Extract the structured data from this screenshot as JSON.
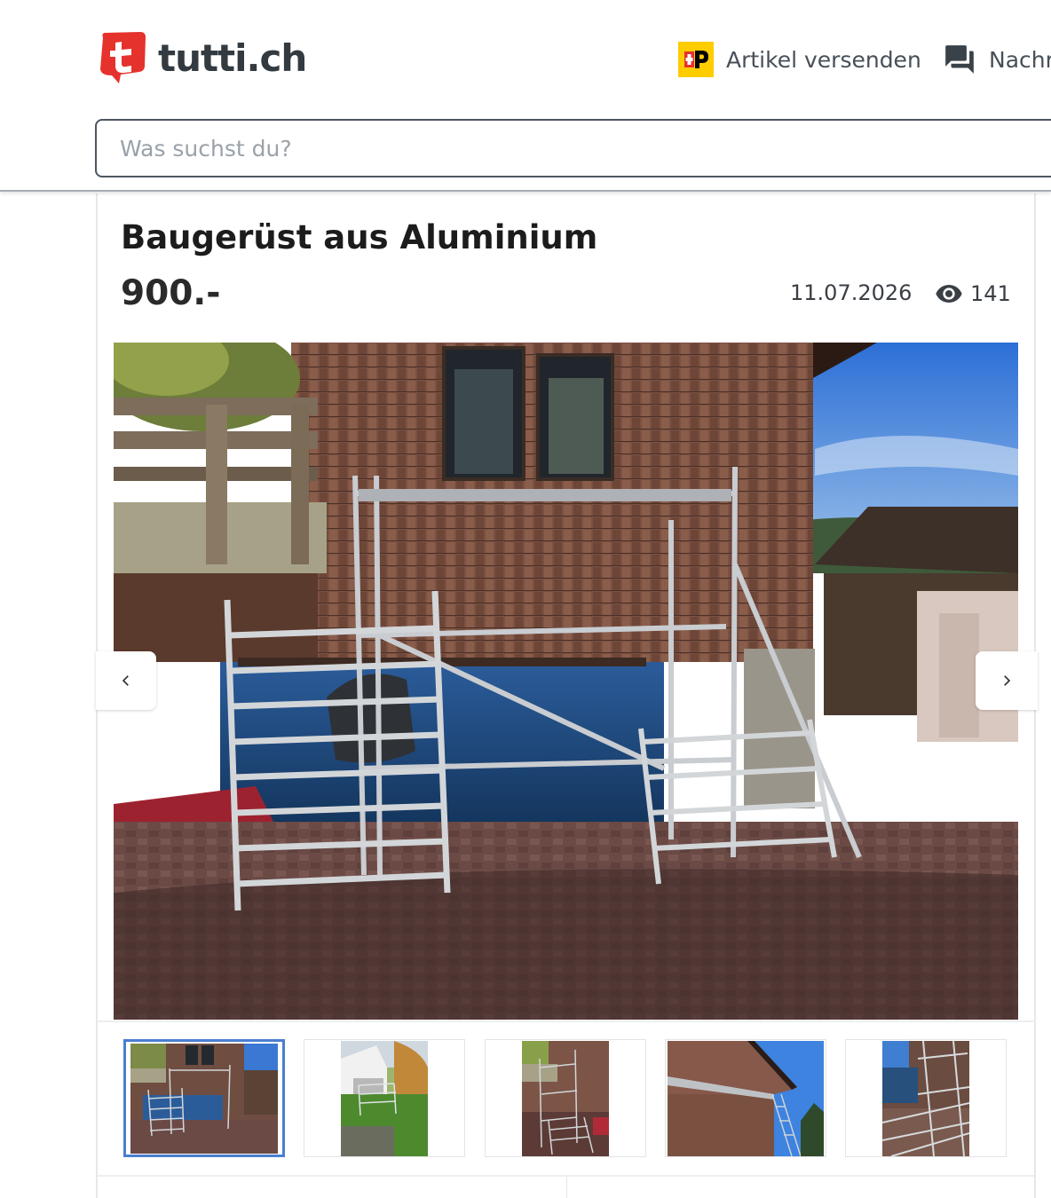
{
  "header": {
    "logo_text": "tutti.ch",
    "ship_label": "Artikel versenden",
    "messages_label": "Nachr",
    "post_icon": "swiss-post-icon",
    "messages_icon": "chat-bubbles-icon"
  },
  "search": {
    "placeholder": "Was suchst du?",
    "value": ""
  },
  "listing": {
    "title": "Baugerüst aus Aluminium",
    "price": "900.-",
    "date": "11.07.2026",
    "views": "141",
    "views_icon": "eye-icon"
  },
  "gallery": {
    "prev_icon": "chevron-left-icon",
    "next_icon": "chevron-right-icon",
    "thumbnail_count": 5,
    "active_thumbnail": 1
  },
  "colors": {
    "brand_red": "#e5322d",
    "post_yellow": "#ffcc00",
    "active_thumb_border": "#4a7fd1"
  }
}
